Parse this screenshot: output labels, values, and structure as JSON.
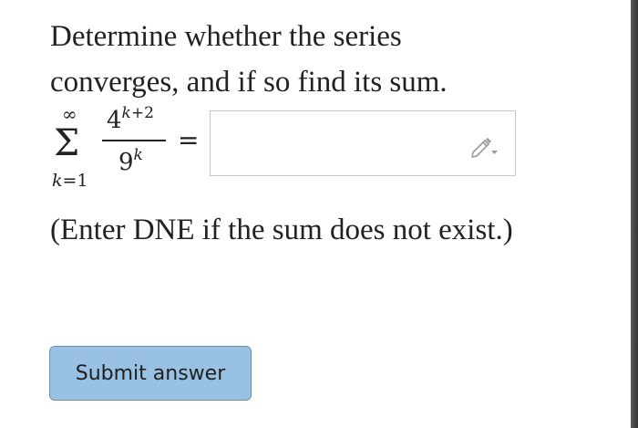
{
  "question": {
    "line1": "Determine whether the series",
    "line2": "converges, and if so find its sum."
  },
  "series": {
    "upper_limit": "∞",
    "sigma": "Σ",
    "lower_var": "k",
    "lower_eq": "=",
    "lower_start": "1",
    "numerator_base": "4",
    "numerator_exp_var": "k",
    "numerator_exp_rest": "+2",
    "denominator_base": "9",
    "denominator_exp": "k",
    "equals": "="
  },
  "answer": {
    "value": "",
    "editor_icon": "pencil-icon"
  },
  "hint": "(Enter DNE if the sum does not exist.)",
  "submit": {
    "label": "Submit answer"
  },
  "colors": {
    "button_bg": "#98c1e4",
    "button_border": "#6f8fa9",
    "text": "#222222"
  }
}
